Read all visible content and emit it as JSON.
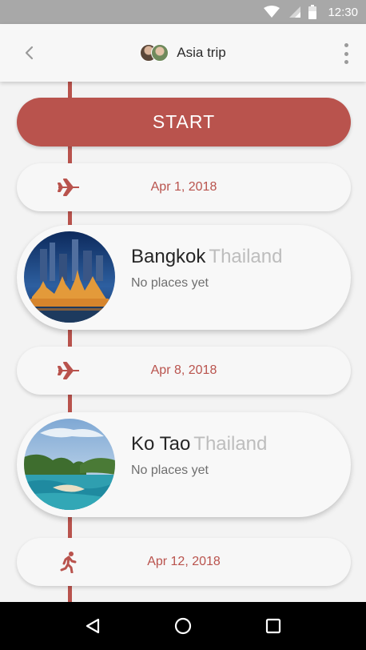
{
  "status_bar": {
    "time": "12:30",
    "icons": [
      "wifi-icon",
      "cellular-signal-icon",
      "battery-icon"
    ]
  },
  "app_bar": {
    "title": "Asia trip",
    "back_icon": "chevron-left-icon",
    "menu_icon": "more-vert-icon",
    "avatars": [
      "avatar-1",
      "avatar-2"
    ]
  },
  "timeline": {
    "start_label": "START",
    "accent_color": "#b9534d",
    "items": [
      {
        "type": "transport",
        "icon": "airplane-icon",
        "date": "Apr 1, 2018"
      },
      {
        "type": "place",
        "city": "Bangkok",
        "country": "Thailand",
        "subtitle": "No places yet",
        "photo": "bangkok-photo"
      },
      {
        "type": "transport",
        "icon": "airplane-icon",
        "date": "Apr 8, 2018"
      },
      {
        "type": "place",
        "city": "Ko Tao",
        "country": "Thailand",
        "subtitle": "No places yet",
        "photo": "ko-tao-photo"
      },
      {
        "type": "transport",
        "icon": "walking-icon",
        "date": "Apr 12, 2018"
      }
    ]
  },
  "nav_bar": {
    "buttons": [
      "back-triangle-icon",
      "home-circle-icon",
      "recents-square-icon"
    ]
  }
}
